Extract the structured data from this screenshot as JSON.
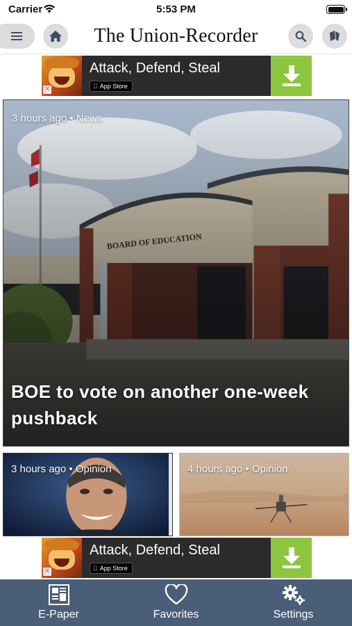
{
  "status_bar": {
    "carrier": "Carrier",
    "time": "5:53 PM"
  },
  "header": {
    "title": "The Union-Recorder",
    "icons": [
      "menu-icon",
      "home-icon",
      "search-icon",
      "brand-icon"
    ]
  },
  "ads": [
    {
      "title": "Attack, Defend, Steal",
      "store_badge": "App Store",
      "close_icon": "x-icon",
      "action_icon": "download-icon"
    },
    {
      "title": "Attack, Defend, Steal",
      "store_badge": "App Store",
      "close_icon": "x-icon",
      "action_icon": "download-icon"
    }
  ],
  "hero": {
    "meta": "3 hours ago • News",
    "title": "BOE to vote on another one-week pushback",
    "sign_text": "BOARD OF EDUCATION"
  },
  "cards": [
    {
      "meta": "3 hours ago • Opinion"
    },
    {
      "meta": "4 hours ago • Opinion"
    }
  ],
  "tabbar": {
    "background": "#4a5e77",
    "tabs": [
      {
        "label": "E-Paper",
        "icon": "newspaper-icon"
      },
      {
        "label": "Favorites",
        "icon": "heart-icon"
      },
      {
        "label": "Settings",
        "icon": "gears-icon"
      }
    ]
  },
  "colors": {
    "ad_background": "#2b2b2b",
    "ad_download": "#8cc63f",
    "header_button": "#dcdcdc"
  }
}
